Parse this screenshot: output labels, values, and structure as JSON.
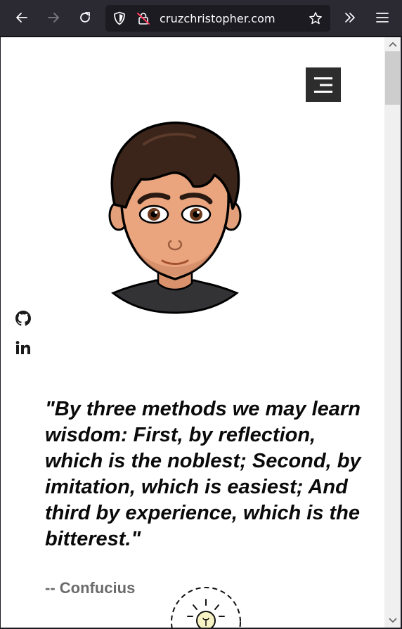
{
  "browser": {
    "url": "cruzchristopher.com",
    "icons": {
      "back": "back-arrow-icon",
      "forward": "forward-arrow-icon",
      "reload": "reload-icon",
      "shield": "tracking-protection-shield-icon",
      "insecure": "insecure-lock-icon",
      "bookmark": "bookmark-star-icon",
      "overflow": "chevron-double-right-icon",
      "menu": "hamburger-menu-icon"
    }
  },
  "page": {
    "menu_icon": "hamburger-menu-icon",
    "avatar": "memoji-avatar",
    "social": [
      "github-icon",
      "linkedin-icon"
    ],
    "quote": "\"By three methods we may learn wisdom: First, by reflection, which is the noblest; Second, by imitation, which is easiest; And third by experience, which is the bitterest.\"",
    "author": "-- Confucius",
    "colors": {
      "quote_text": "#0a0a0a",
      "author_text": "#6b6b6b",
      "menu_button_bg": "#2d2d2d",
      "chrome_bg": "#2b2a33"
    }
  }
}
